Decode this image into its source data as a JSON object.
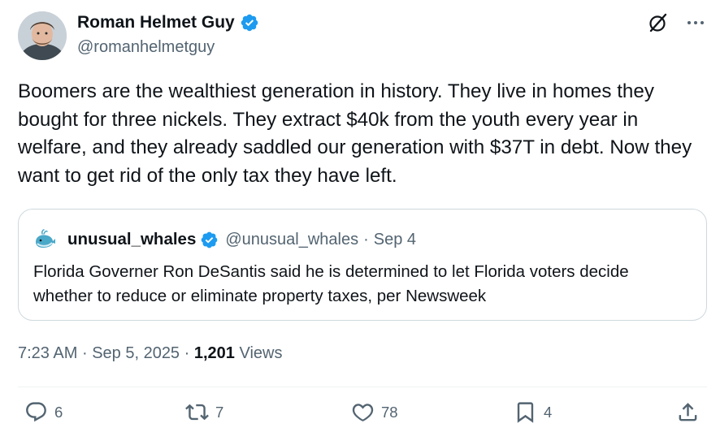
{
  "author": {
    "name": "Roman Helmet Guy",
    "handle": "@romanhelmetguy",
    "verified": true
  },
  "top_actions": {
    "grok_icon": "grok-icon",
    "more_icon": "more-icon"
  },
  "tweet": {
    "text": "Boomers are the wealthiest generation in history. They live in homes they bought for three nickels. They extract $40k from the youth every year in welfare, and they already saddled our generation with $37T in debt. Now they want to get rid of the only tax they have left."
  },
  "quote": {
    "name": "unusual_whales",
    "handle": "@unusual_whales",
    "separator": "·",
    "date": "Sep 4",
    "text": "Florida Governer Ron DeSantis said he is determined to let Florida voters decide whether to reduce or eliminate property taxes, per Newsweek"
  },
  "meta": {
    "time": "7:23 AM",
    "sep1": "·",
    "date": "Sep 5, 2025",
    "sep2": "·",
    "views_count": "1,201",
    "views_label": "Views"
  },
  "actions": {
    "reply": "6",
    "retweet": "7",
    "like": "78",
    "bookmark": "4"
  },
  "colors": {
    "text": "#0f1419",
    "secondary": "#536471",
    "verified": "#1d9bf0",
    "border": "#cfd9de"
  }
}
